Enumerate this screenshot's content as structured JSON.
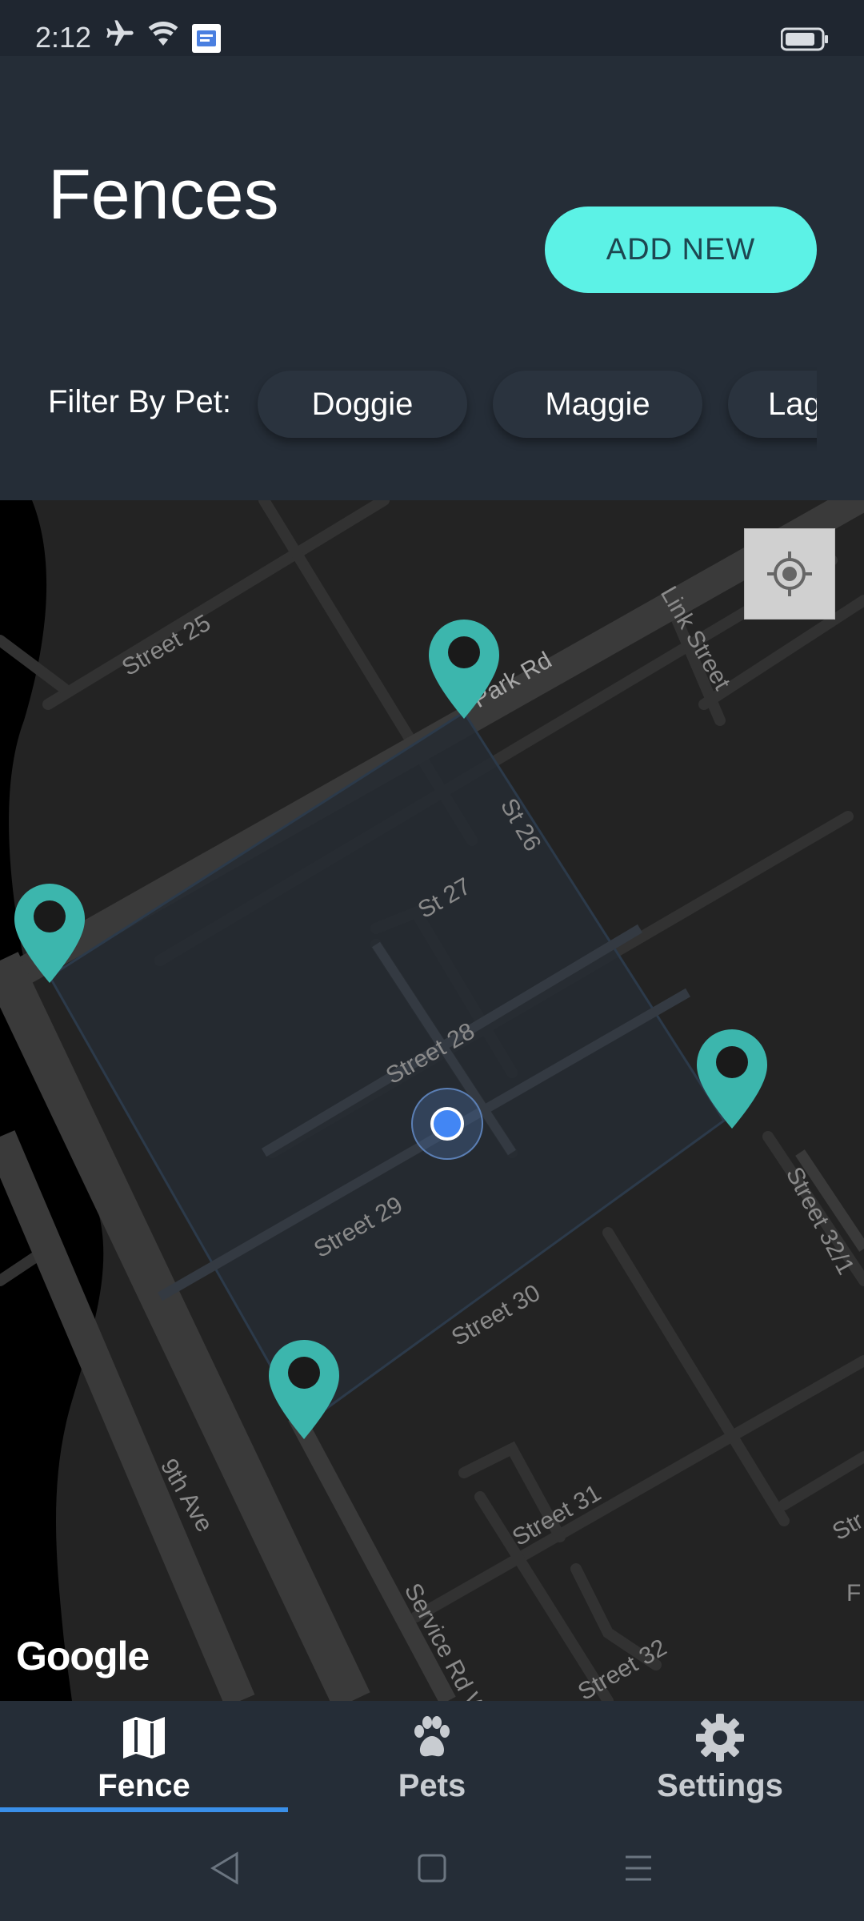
{
  "status_bar": {
    "time": "2:12",
    "icons": [
      "airplane-mode-icon",
      "wifi-icon",
      "app-notification-icon",
      "battery-icon"
    ]
  },
  "header": {
    "title": "Fences",
    "add_button_label": "ADD NEW",
    "filter_label": "Filter By Pet:",
    "pets": [
      "Doggie",
      "Maggie",
      "Lag"
    ]
  },
  "map": {
    "streets": [
      "Street 25",
      "Park Rd",
      "Link Street",
      "St 26",
      "St 27",
      "Street 28",
      "Street 29",
      "Street 30",
      "Street 31",
      "Street 32",
      "Street 32/1",
      "9th Ave",
      "Service Rd W",
      "Str",
      "F"
    ],
    "attribution": "Google",
    "locate_icon": "my-location-icon",
    "marker_icon": "map-pin-icon",
    "current_location": "blue-dot-icon",
    "colors": {
      "marker": "#3cb6ad",
      "fence_fill": "#262b33",
      "road": "#3a3a3a",
      "water": "#000000"
    }
  },
  "nav": {
    "items": [
      {
        "label": "Fence",
        "icon": "map-icon",
        "active": true
      },
      {
        "label": "Pets",
        "icon": "paw-icon",
        "active": false
      },
      {
        "label": "Settings",
        "icon": "gear-icon",
        "active": false
      }
    ],
    "active_color": "#ffffff",
    "inactive_color": "#c8ccd1",
    "indicator_color": "#3a8fe8"
  },
  "system_nav": [
    "back-icon",
    "home-icon",
    "recents-icon"
  ]
}
